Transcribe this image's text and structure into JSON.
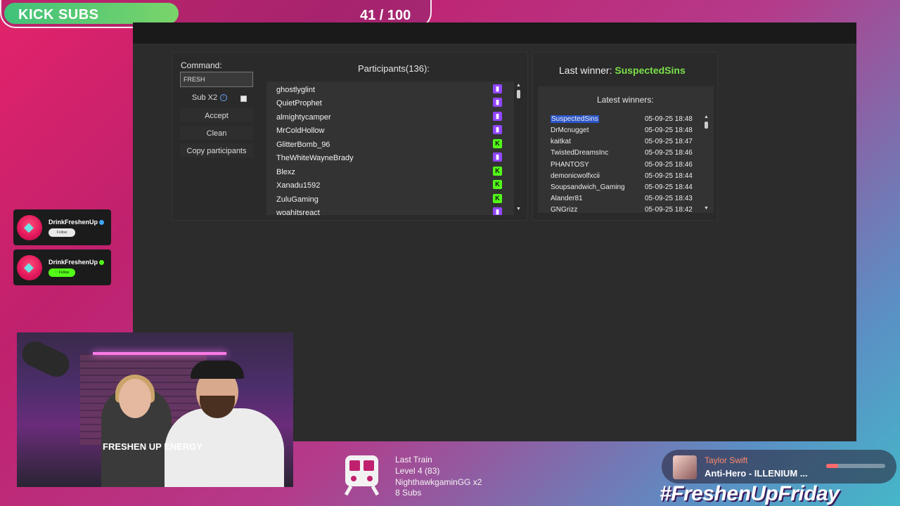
{
  "goal": {
    "label": "KICK SUBS",
    "current": 41,
    "target": 100,
    "count_text": "41 / 100"
  },
  "giveaway": {
    "command_label": "Command:",
    "command_value": "FRESH",
    "sub_x2_label": "Sub X2",
    "sub_x2_info": "i",
    "accept_label": "Accept",
    "clean_label": "Clean",
    "copy_label": "Copy participants",
    "participants_title": "Participants(136):",
    "participants": [
      {
        "name": "ghostlyglint",
        "platform": "twitch"
      },
      {
        "name": "QuietProphet",
        "platform": "twitch"
      },
      {
        "name": "almightycamper",
        "platform": "twitch"
      },
      {
        "name": "MrColdHollow",
        "platform": "twitch"
      },
      {
        "name": "GlitterBomb_96",
        "platform": "kick"
      },
      {
        "name": "TheWhiteWayneBrady",
        "platform": "twitch"
      },
      {
        "name": "Blexz",
        "platform": "kick"
      },
      {
        "name": "Xanadu1592",
        "platform": "kick"
      },
      {
        "name": "ZuluGaming",
        "platform": "kick"
      },
      {
        "name": "woahitsreact",
        "platform": "twitch"
      }
    ],
    "last_winner_label": "Last winner:",
    "last_winner": "SuspectedSins",
    "latest_winners_title": "Latest winners:",
    "winners": [
      {
        "name": "SuspectedSins",
        "time": "05-09-25 18:48"
      },
      {
        "name": "DrMcnugget",
        "time": "05-09-25 18:48"
      },
      {
        "name": "kaitkat",
        "time": "05-09-25 18:47"
      },
      {
        "name": "TwistedDreamsInc",
        "time": "05-09-25 18:46"
      },
      {
        "name": "PHANTOSY",
        "time": "05-09-25 18:46"
      },
      {
        "name": "demonicwolfxcii",
        "time": "05-09-25 18:44"
      },
      {
        "name": "Soupsandwich_Gaming",
        "time": "05-09-25 18:44"
      },
      {
        "name": "Alander81",
        "time": "05-09-25 18:43"
      },
      {
        "name": "GNGrizz",
        "time": "05-09-25 18:42"
      }
    ]
  },
  "follow_cards": [
    {
      "name": "DrinkFreshenUp",
      "button": "Follow",
      "verified_color": "#3ea6ff",
      "button_bg": "#e8e8e8",
      "button_color": "#333"
    },
    {
      "name": "DrinkFreshenUp",
      "button": "♡ Follow",
      "verified_color": "#53fc18",
      "button_bg": "#53fc18",
      "button_color": "#0d0d0d"
    }
  ],
  "webcam": {
    "shirt_text": "FRESHEN UP ENERGY"
  },
  "train": {
    "title": "Last Train",
    "level": "Level 4  (83)",
    "user": "NighthawkgaminGG x2",
    "subs": "8 Subs"
  },
  "now_playing": {
    "artist": "Taylor Swift",
    "song": "Anti-Hero - ILLENIUM ...",
    "progress": 0.2
  },
  "hashtag": "#FreshenUpFriday",
  "colors": {
    "kick": "#53fc18",
    "twitch": "#9146ff",
    "winner": "#7be04a",
    "selection": "#2b55c8"
  }
}
